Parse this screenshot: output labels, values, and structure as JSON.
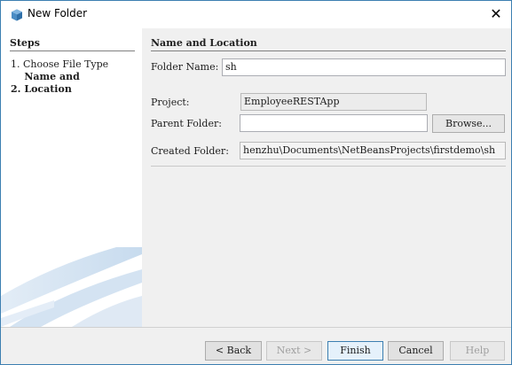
{
  "window": {
    "title": "New Folder",
    "close_glyph": "✕"
  },
  "steps": {
    "heading": "Steps",
    "items": [
      {
        "number": "1.",
        "label": "Choose File Type"
      },
      {
        "number": "2.",
        "label": "Name and Location"
      }
    ],
    "current_index": 1
  },
  "main": {
    "heading": "Name and Location",
    "folder_name_label": "Folder Name:",
    "folder_name_value": "sh",
    "project_label": "Project:",
    "project_value": "EmployeeRESTApp",
    "parent_folder_label": "Parent Folder:",
    "parent_folder_value": "",
    "browse_label": "Browse...",
    "created_folder_label": "Created Folder:",
    "created_folder_value": "henzhu\\Documents\\NetBeansProjects\\firstdemo\\sh"
  },
  "footer": {
    "back_label": "< Back",
    "next_label": "Next >",
    "finish_label": "Finish",
    "cancel_label": "Cancel",
    "help_label": "Help"
  },
  "colors": {
    "window_border": "#3c7fb1",
    "default_button_border": "#3c7fb1",
    "disabled_text": "#a0a0a0"
  },
  "icons": {
    "window_icon": "netbeans-cube-icon",
    "close": "close-icon"
  }
}
